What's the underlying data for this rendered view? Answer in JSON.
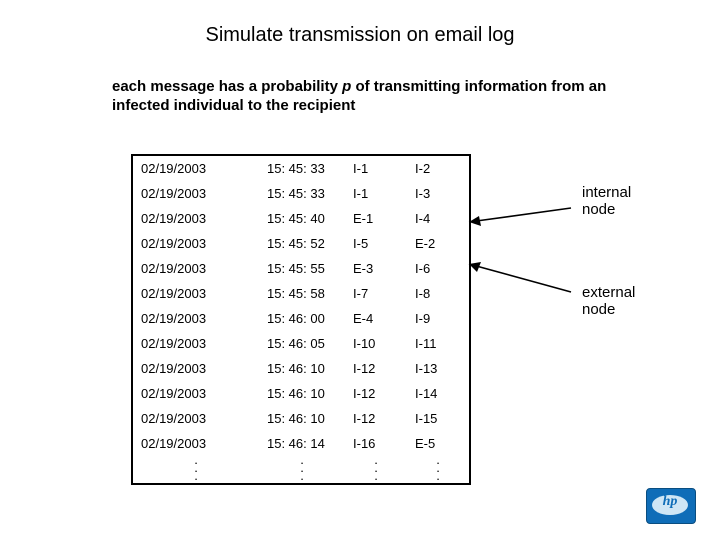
{
  "title": "Simulate transmission on email log",
  "subtitle_a": "each message has a probability ",
  "subtitle_p": "p",
  "subtitle_b": " of  transmitting information from an infected individual to the recipient",
  "rows": [
    {
      "date": "02/19/2003",
      "time": "15: 45: 33",
      "a": "I-1",
      "b": "I-2"
    },
    {
      "date": "02/19/2003",
      "time": "15: 45: 33",
      "a": "I-1",
      "b": "I-3"
    },
    {
      "date": "02/19/2003",
      "time": "15: 45: 40",
      "a": "E-1",
      "b": "I-4"
    },
    {
      "date": "02/19/2003",
      "time": "15: 45: 52",
      "a": "I-5",
      "b": "E-2"
    },
    {
      "date": "02/19/2003",
      "time": "15: 45: 55",
      "a": "E-3",
      "b": "I-6"
    },
    {
      "date": "02/19/2003",
      "time": "15: 45: 58",
      "a": "I-7",
      "b": "I-8"
    },
    {
      "date": "02/19/2003",
      "time": "15: 46: 00",
      "a": "E-4",
      "b": "I-9"
    },
    {
      "date": "02/19/2003",
      "time": "15: 46: 05",
      "a": "I-10",
      "b": "I-11"
    },
    {
      "date": "02/19/2003",
      "time": "15: 46: 10",
      "a": "I-12",
      "b": "I-13"
    },
    {
      "date": "02/19/2003",
      "time": "15: 46: 10",
      "a": "I-12",
      "b": "I-14"
    },
    {
      "date": "02/19/2003",
      "time": "15: 46: 10",
      "a": "I-12",
      "b": "I-15"
    },
    {
      "date": "02/19/2003",
      "time": "15: 46: 14",
      "a": "I-16",
      "b": "E-5"
    }
  ],
  "annot_internal": "internal node",
  "annot_external": "external node",
  "logo_text": "hp"
}
